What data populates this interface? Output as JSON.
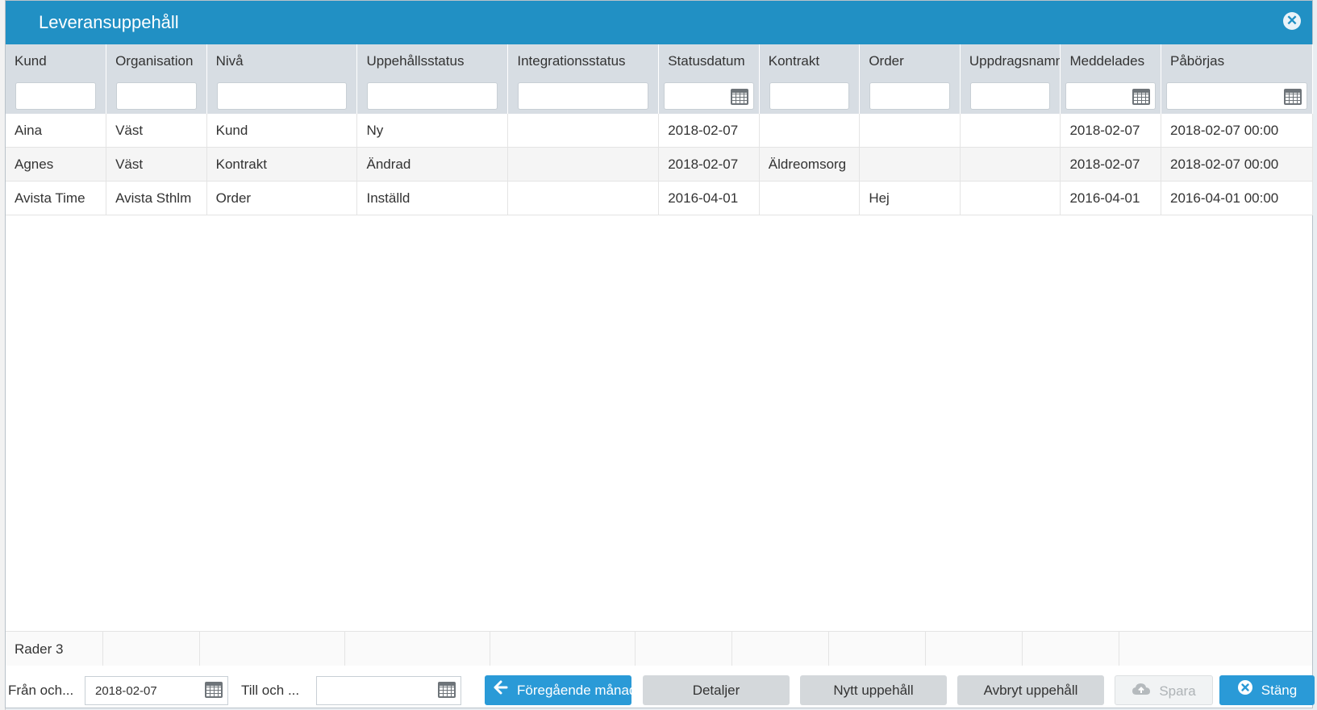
{
  "dialog": {
    "title": "Leveransuppehåll",
    "close_icon": "close-icon"
  },
  "grid": {
    "columns": [
      "Kund",
      "Organisation",
      "Nivå",
      "Uppehållsstatus",
      "Integrationsstatus",
      "Statusdatum",
      "Kontrakt",
      "Order",
      "Uppdragsnamn",
      "Meddelades",
      "Påbörjas"
    ],
    "rows": [
      [
        "Aina",
        "Väst",
        "Kund",
        "Ny",
        "",
        "2018-02-07",
        "",
        "",
        "",
        "2018-02-07",
        "2018-02-07 00:00"
      ],
      [
        "Agnes",
        "Väst",
        "Kontrakt",
        "Ändrad",
        "",
        "2018-02-07",
        "Äldreomsorg",
        "",
        "",
        "2018-02-07",
        "2018-02-07 00:00"
      ],
      [
        "Avista Time",
        "Avista Sthlm",
        "Order",
        "Inställd",
        "",
        "2016-04-01",
        "",
        "Hej",
        "",
        "2016-04-01",
        "2016-04-01 00:00"
      ]
    ],
    "footer_text": "Rader 3"
  },
  "toolbar": {
    "from_label": "Från och...",
    "from_value": "2018-02-07",
    "to_label": "Till och ...",
    "to_value": "",
    "prev_month": "Föregående månad",
    "details": "Detaljer",
    "new_pause": "Nytt uppehåll",
    "cancel_pause": "Avbryt uppehåll",
    "save": "Spara",
    "close": "Stäng"
  },
  "colors": {
    "accent": "#2190c4",
    "button_blue": "#2a9ad7",
    "header_bg": "#d7dde3"
  }
}
